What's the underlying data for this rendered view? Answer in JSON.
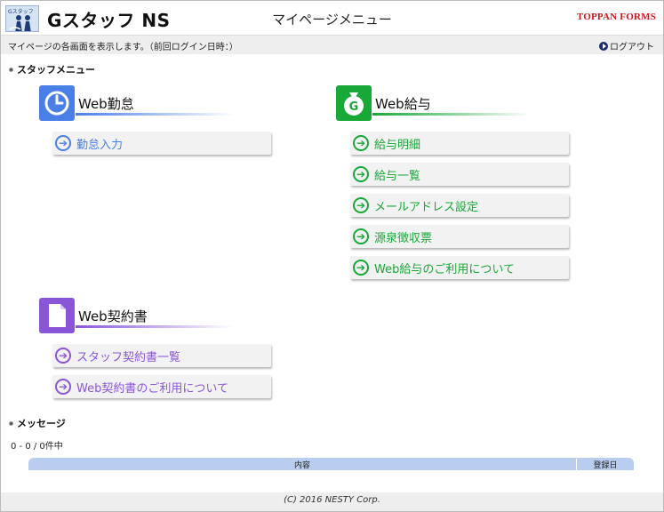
{
  "header": {
    "app_name": "Gスタッフ NS",
    "page_title": "マイページメニュー",
    "brand": "TOPPAN FORMS",
    "logo_tag": "Gスタッフ"
  },
  "status": {
    "text": "マイページの各画面を表示します。（前回ログイン日時：）",
    "logout_label": "ログアウト"
  },
  "staff_menu": {
    "heading": "スタッフメニュー",
    "groups": [
      {
        "id": "kintai",
        "title": "Web勤怠",
        "color": "#4b7fe8",
        "icon": "clock-icon",
        "items": [
          "勤怠入力"
        ]
      },
      {
        "id": "kyuyo",
        "title": "Web給与",
        "color": "#18a838",
        "icon": "money-bag-icon",
        "items": [
          "給与明細",
          "給与一覧",
          "メールアドレス設定",
          "源泉徴収票",
          "Web給与のご利用について"
        ]
      },
      {
        "id": "keiyaku",
        "title": "Web契約書",
        "color": "#8a56d8",
        "icon": "document-icon",
        "items": [
          "スタッフ契約書一覧",
          "Web契約書のご利用について"
        ]
      }
    ]
  },
  "messages": {
    "heading": "メッセージ",
    "count_text": "0 - 0 / 0件中",
    "columns": [
      "内容",
      "登録日"
    ]
  },
  "footer": {
    "text": "(C) 2016 NESTY Corp."
  }
}
